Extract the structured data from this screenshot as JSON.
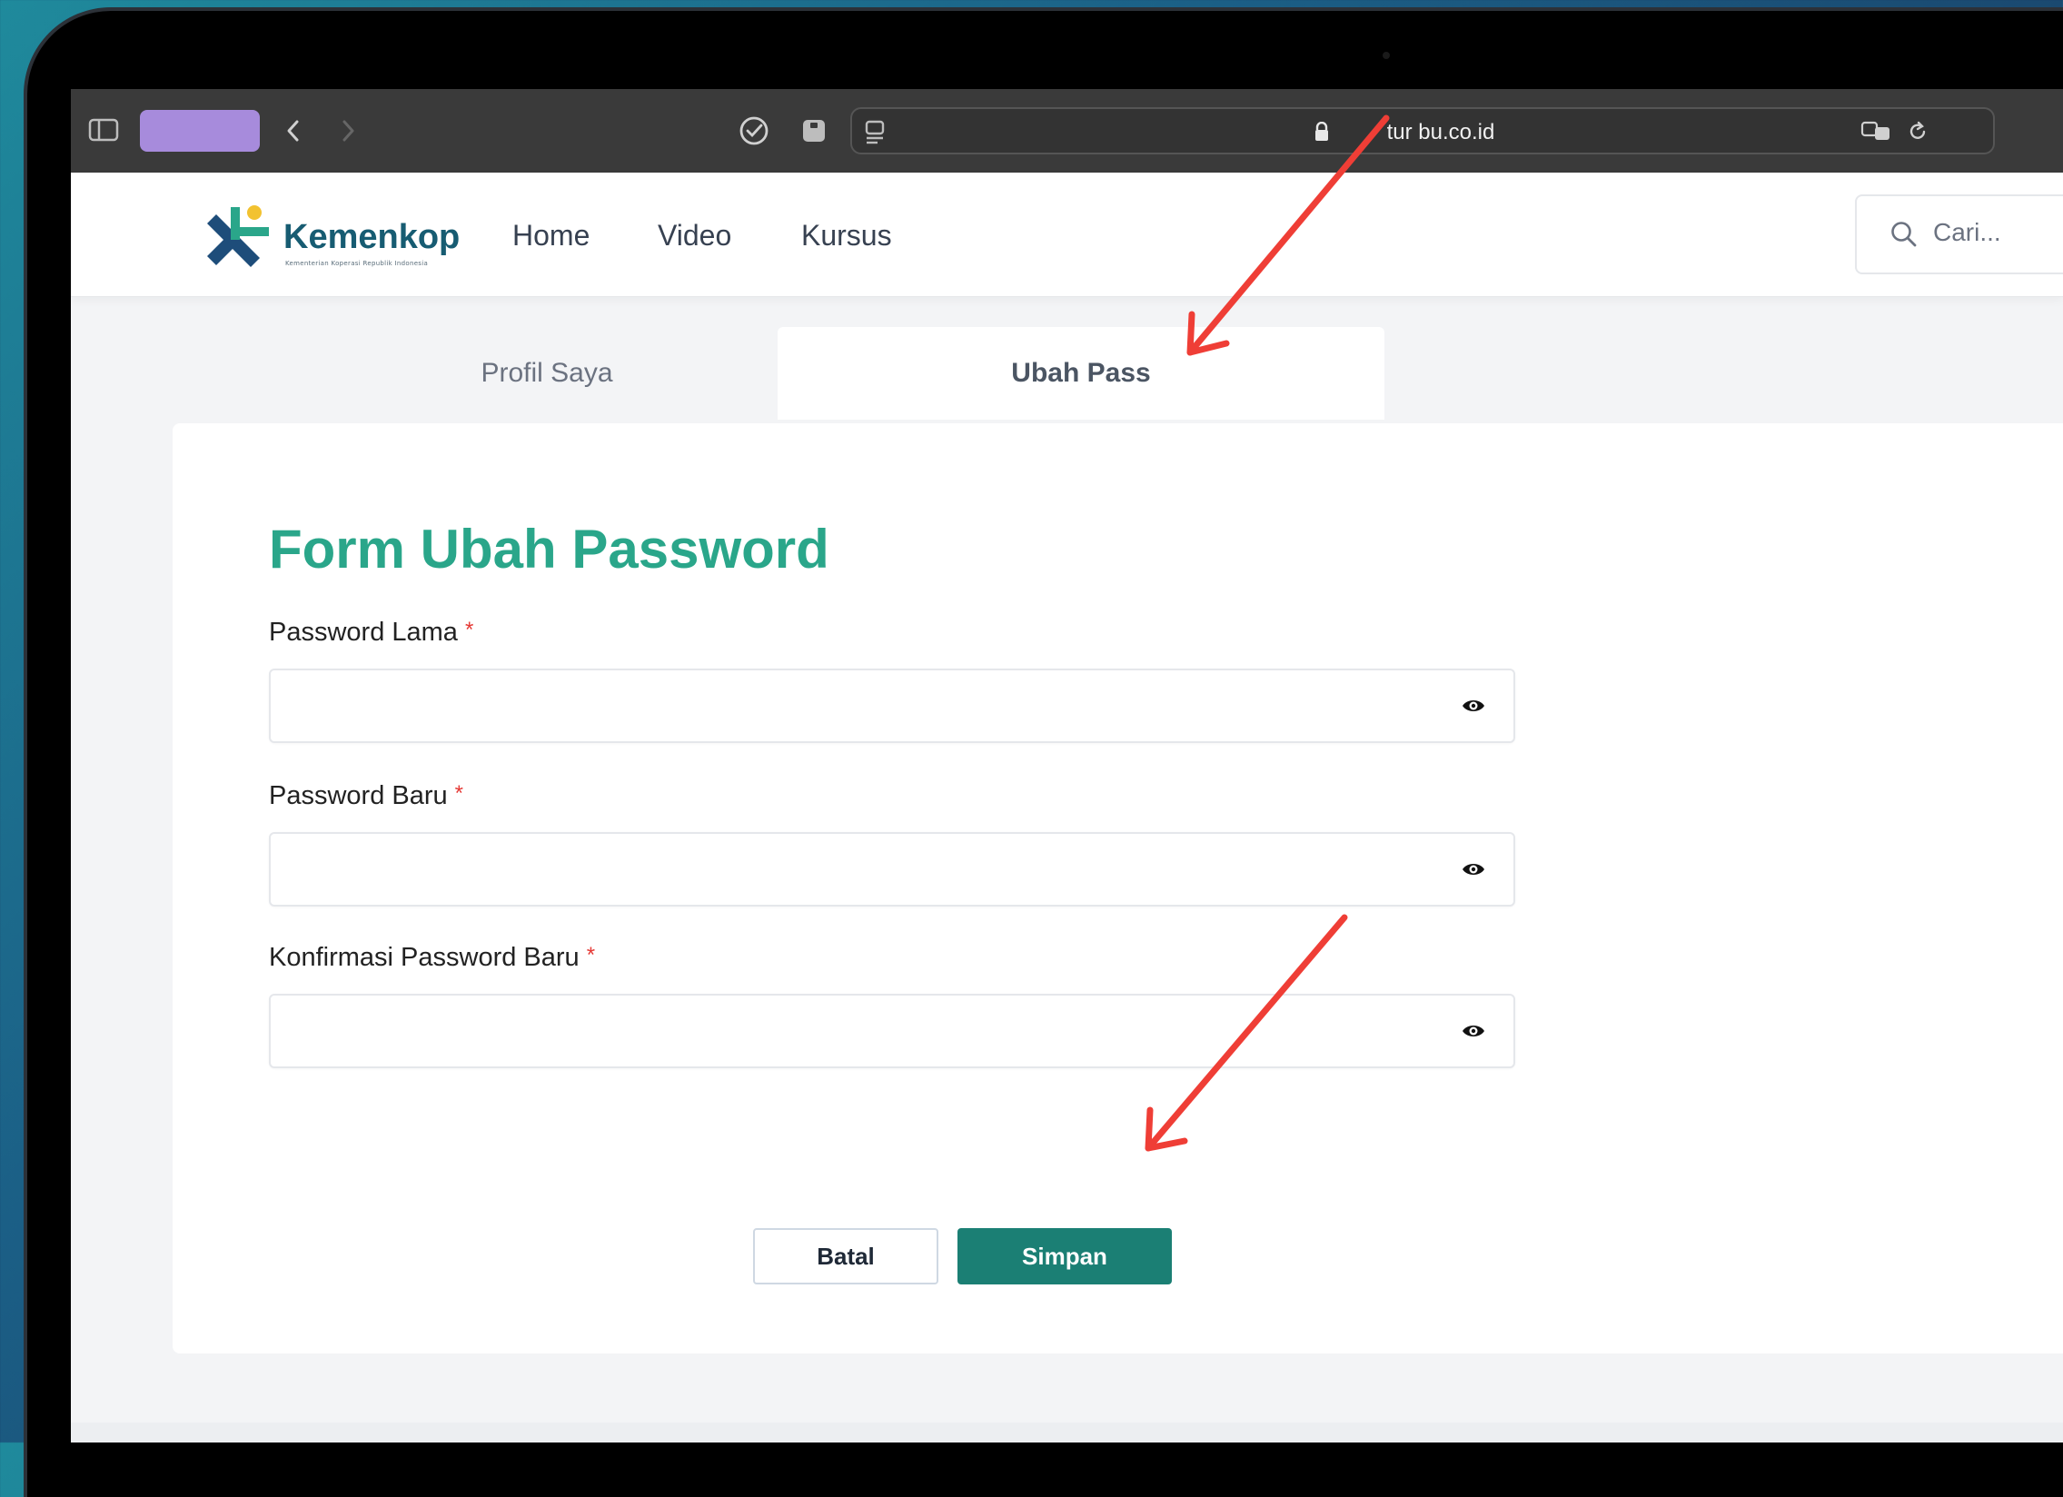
{
  "browser": {
    "url": "tur bu.co.id",
    "tab_color": "#a78bdc"
  },
  "site": {
    "logo_text": "Kemenkop",
    "logo_subtitle": "Kementerian Koperasi Republik Indonesia",
    "nav": [
      "Home",
      "Video",
      "Kursus"
    ],
    "search_placeholder": "Cari..."
  },
  "tabs": {
    "profil": "Profil Saya",
    "ubah": "Ubah Pass",
    "active": "Ubah Pass"
  },
  "form": {
    "title": "Form Ubah Password",
    "fields": [
      {
        "label": "Password Lama",
        "required_mark": "*",
        "value": ""
      },
      {
        "label": "Password Baru",
        "required_mark": "*",
        "value": ""
      },
      {
        "label": "Konfirmasi Password Baru",
        "required_mark": "*",
        "value": ""
      }
    ],
    "cancel_label": "Batal",
    "save_label": "Simpan"
  },
  "colors": {
    "title_green": "#2aa68a",
    "save_button": "#1b7f74",
    "required_red": "#e53935",
    "annotation_arrow": "#ef3e36",
    "logo_navy": "#175c72"
  }
}
